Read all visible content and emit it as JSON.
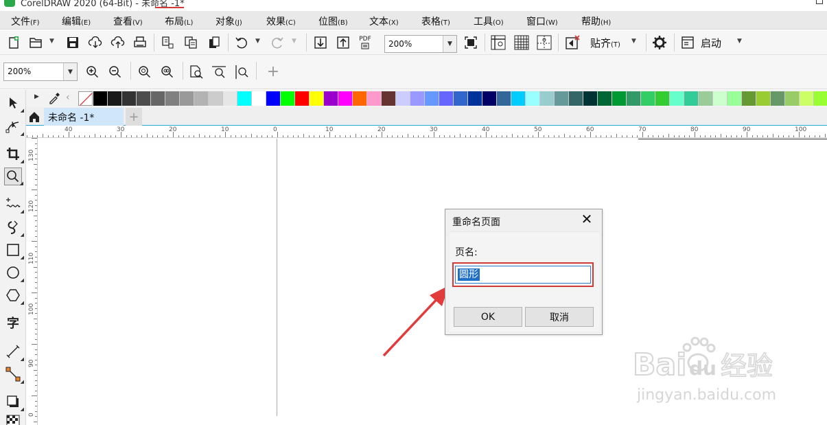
{
  "titlebar": {
    "text": "CorelDRAW 2020 (64-Bit) - 未命名 -1*"
  },
  "menu": [
    {
      "label": "文件",
      "key": "(F)"
    },
    {
      "label": "编辑",
      "key": "(E)"
    },
    {
      "label": "查看",
      "key": "(V)"
    },
    {
      "label": "布局",
      "key": "(L)"
    },
    {
      "label": "对象",
      "key": "(J)"
    },
    {
      "label": "效果",
      "key": "(C)"
    },
    {
      "label": "位图",
      "key": "(B)"
    },
    {
      "label": "文本",
      "key": "(X)"
    },
    {
      "label": "表格",
      "key": "(T)"
    },
    {
      "label": "工具",
      "key": "(O)"
    },
    {
      "label": "窗口",
      "key": "(W)"
    },
    {
      "label": "帮助",
      "key": "(H)"
    }
  ],
  "toolbar": {
    "zoom_value": "200%",
    "snap_label": "贴齐",
    "snap_key": "(T)",
    "launch_label": "启动",
    "pdf_label": "PDF"
  },
  "toolbar2": {
    "zoom_value": "200%"
  },
  "tabs": {
    "document": "未命名 -1*"
  },
  "ruler": {
    "h_labels": [
      "40",
      "30",
      "20",
      "10",
      "0",
      "10",
      "20",
      "30",
      "40",
      "50",
      "60",
      "70",
      "80",
      "90",
      "100"
    ],
    "v_labels": [
      "130",
      "120",
      "110",
      "100",
      "90",
      "0"
    ]
  },
  "dialog": {
    "title": "重命名页面",
    "field_label": "页名:",
    "field_value": "圆形",
    "ok_label": "OK",
    "cancel_label": "取消"
  },
  "watermark": {
    "brand": "Bai",
    "brand2": "du",
    "cn": "经验",
    "url": "jingyan.baidu.com"
  },
  "colors": {
    "accent": "#22a6d6",
    "highlight": "#d23a3a",
    "selection": "#1f6fc9",
    "palette": [
      "#000000",
      "#1a1a1a",
      "#333333",
      "#4d4d4d",
      "#666666",
      "#808080",
      "#999999",
      "#b3b3b3",
      "#cccccc",
      "#e6e6e6",
      "#00ffff",
      "#ffffff",
      "#0000ff",
      "#00ff00",
      "#ff0000",
      "#ffff00",
      "#9900cc",
      "#ff00ff",
      "#ff6600",
      "#ff99cc",
      "#663333",
      "#ccccff",
      "#9999ff",
      "#6699ff",
      "#6666ff",
      "#3366cc",
      "#003399",
      "#000066",
      "#336699",
      "#00ccff",
      "#99ffff",
      "#99cccc",
      "#669999",
      "#336666",
      "#003333",
      "#006633",
      "#009933",
      "#339966",
      "#33cc66",
      "#33cc33",
      "#66ffcc",
      "#33cc99",
      "#99cc99",
      "#ccffcc",
      "#99ff99",
      "#669933",
      "#99cc33",
      "#669966",
      "#99cc66",
      "#ccff66",
      "#99ff33"
    ]
  }
}
